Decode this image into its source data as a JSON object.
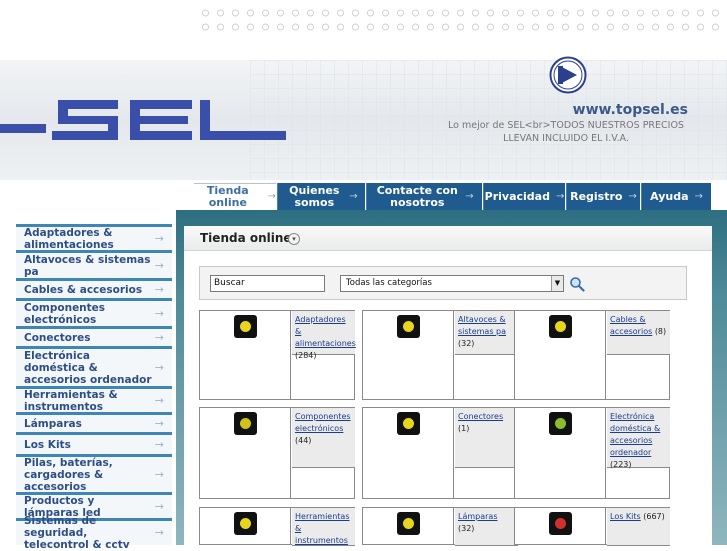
{
  "header": {
    "url": "www.topsel.es",
    "slogan": "Lo mejor de SEL<br>TODOS NUESTROS PRECIOS LLEVAN INCLUIDO EL I.V.A.",
    "brand_color": "#3a4faa"
  },
  "nav": {
    "tabs": [
      {
        "label": "Tienda online",
        "active": true
      },
      {
        "label": "Quienes somos",
        "active": false
      },
      {
        "label": "Contacte con nosotros",
        "active": false
      },
      {
        "label": "Privacidad",
        "active": false
      },
      {
        "label": "Registro",
        "active": false
      },
      {
        "label": "Ayuda",
        "active": false
      }
    ]
  },
  "sidebar": {
    "items": [
      {
        "label": "Adaptadores & alimentaciones"
      },
      {
        "label": "Altavoces & sistemas pa"
      },
      {
        "label": "Cables & accesorios"
      },
      {
        "label": "Componentes electrónicos"
      },
      {
        "label": "Conectores"
      },
      {
        "label": "Electrónica doméstica & accesorios ordenador"
      },
      {
        "label": "Herramientas & instrumentos"
      },
      {
        "label": "Lámparas"
      },
      {
        "label": "Los Kits"
      },
      {
        "label": "Pilas, baterías, cargadores & accesorios"
      },
      {
        "label": "Productos y lámparas led"
      },
      {
        "label": "Sistemas de seguridad, telecontrol & cctv"
      }
    ]
  },
  "main": {
    "title": "Tienda online",
    "search": {
      "value": "Buscar",
      "category_selected": "Todas las categorías"
    },
    "categories": [
      {
        "name": "Adaptadores & alimentaciones",
        "count": "(284)",
        "icon": "socket-icon",
        "icon_color": "#e8d51e"
      },
      {
        "name": "Altavoces & sistemas pa",
        "count": "(32)",
        "icon": "speaker-icon",
        "icon_color": "#e8d51e"
      },
      {
        "name": "Cables & accesorios",
        "count": "(8)",
        "icon": "cable-icon",
        "icon_color": "#e8d51e"
      },
      {
        "name": "Componentes electrónicos",
        "count": "(44)",
        "icon": "chip-icon",
        "icon_color": "#cfc21a"
      },
      {
        "name": "Conectores",
        "count": "(1)",
        "icon": "connector-icon",
        "icon_color": "#e8d51e"
      },
      {
        "name": "Electrónica doméstica & accesorios ordenador",
        "count": "(223)",
        "icon": "person-icon",
        "icon_color": "#8bbf2a"
      },
      {
        "name": "Herramientas & instrumentos",
        "count": "",
        "icon": "tools-icon",
        "icon_color": "#e8d51e"
      },
      {
        "name": "Lámparas",
        "count": "(32)",
        "icon": "lamp-icon",
        "icon_color": "#e8d51e"
      },
      {
        "name": "Los Kits",
        "count": "(667)",
        "icon": "kit-icon",
        "icon_color": "#d0312d"
      }
    ]
  }
}
